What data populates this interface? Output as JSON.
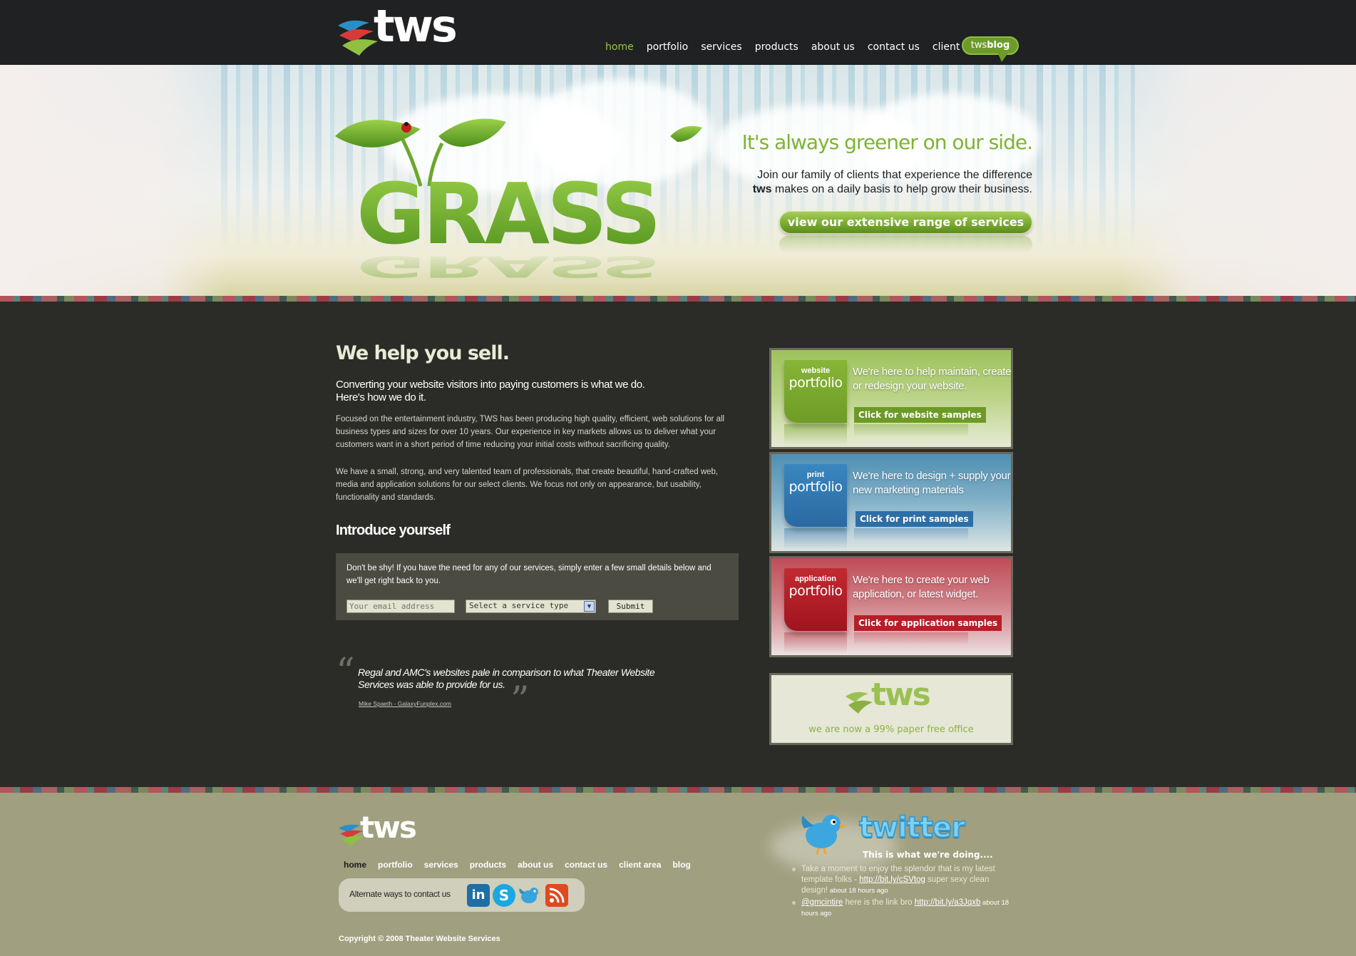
{
  "header": {
    "logo_text": "tws",
    "nav": [
      {
        "label": "home",
        "active": true
      },
      {
        "label": "portfolio"
      },
      {
        "label": "services"
      },
      {
        "label": "products"
      },
      {
        "label": "about us"
      },
      {
        "label": "contact us"
      },
      {
        "label": "client area"
      }
    ],
    "blog_tab": {
      "prefix": "tws",
      "suffix": "blog"
    }
  },
  "hero": {
    "art_text": "GRASS",
    "headline": "It's always greener on our side.",
    "text_line1": "Join our family of clients that experience the difference",
    "text_brand": "tws",
    "text_line2": " makes on a daily basis to help grow their business.",
    "button_label": "view our extensive range of services"
  },
  "main": {
    "title": "We help you sell.",
    "lead_line1": "Converting your website visitors into paying customers is what we do.",
    "lead_line2": "Here's how we do it.",
    "para1": "Focused on the entertainment industry, TWS has been producing high quality, efficient, web solutions for all business types and sizes for over 10 years. Our experience in key markets allows us to deliver what your customers want in a short period of time reducing your initial costs without sacrificing quality.",
    "para2": "We have a small, strong, and very talented team of professionals, that create beautiful, hand-crafted web, media and application solutions for our select clients. We focus not only on appearance, but usability, functionality and standards.",
    "intro_title": "Introduce yourself",
    "contact_text": "Don't be shy! If you have the need for any of our services, simply enter a few small details below and we'll get right back to you.",
    "email_placeholder": "Your email address",
    "service_select_value": "Select a service type",
    "submit_label": "Submit",
    "quote_text": "Regal and AMC's websites pale in comparison to what Theater Website Services was able to provide for us.",
    "quote_cite": "Mike Spaeth - GalaxyFunplex.com"
  },
  "panels": {
    "web": {
      "small": "website",
      "big": "portfolio",
      "text": "We're here to help maintain, create or redesign your website.",
      "button": "Click for website samples"
    },
    "print": {
      "small": "print",
      "big": "portfolio",
      "text": "We're here to design + supply your new marketing materials",
      "button": "Click for print samples"
    },
    "app": {
      "small": "application",
      "big": "portfolio",
      "text": "We're here to create your web application, or latest widget.",
      "button": "Click for application samples"
    },
    "paper": {
      "logo_text": "tws",
      "text": "we are now a 99% paper free office"
    }
  },
  "footer": {
    "logo_text": "tws",
    "nav": [
      {
        "label": "home",
        "active": true
      },
      {
        "label": "portfolio"
      },
      {
        "label": "services"
      },
      {
        "label": "products"
      },
      {
        "label": "about us"
      },
      {
        "label": "contact us"
      },
      {
        "label": "client area"
      },
      {
        "label": "blog"
      }
    ],
    "alt_contact_label": "Alternate ways to contact us",
    "social": [
      "linkedin-icon",
      "skype-icon",
      "twitter-bird-icon",
      "rss-icon"
    ],
    "copyright": "Copyright © 2008 Theater Website Services",
    "twitter": {
      "word": "twitter",
      "subtitle": "This is what we're doing....",
      "tweets": [
        {
          "text": "Take a moment to enjoy the splendor that is my latest template folks - ",
          "link": "http://bit.ly/cSVtog",
          "text2": " super sexy clean design!",
          "time": " about 18 hours ago"
        },
        {
          "mention": "@gmcintire",
          "text": " here is the link bro ",
          "link": "http://bit.ly/a3Jqxb",
          "time": " about 18 hours ago"
        }
      ]
    }
  }
}
